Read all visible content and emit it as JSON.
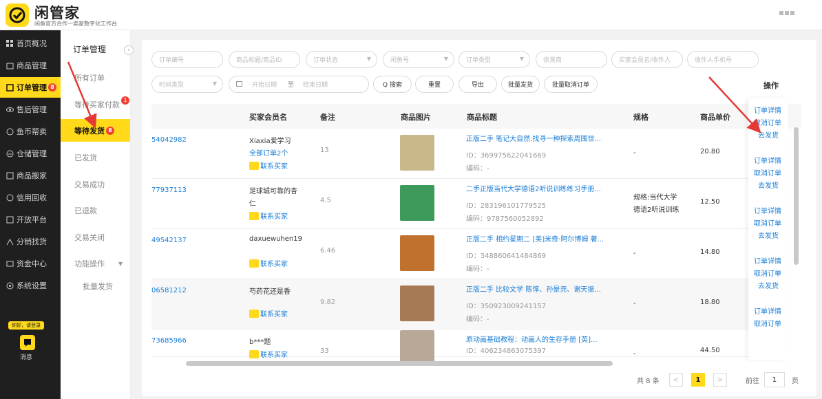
{
  "brand": {
    "title": "闲管家",
    "subtitle": "闲鱼官方合作一卖家数字化工作台"
  },
  "sidebar": {
    "items": [
      {
        "label": "首页概况",
        "icon": "grid-icon"
      },
      {
        "label": "商品管理",
        "icon": "box-icon"
      },
      {
        "label": "订单管理",
        "icon": "order-icon",
        "badge": "8"
      },
      {
        "label": "售后管理",
        "icon": "eye-icon"
      },
      {
        "label": "鱼币帮卖",
        "icon": "coin-icon"
      },
      {
        "label": "仓储管理",
        "icon": "warehouse-icon"
      },
      {
        "label": "商品搬家",
        "icon": "move-icon"
      },
      {
        "label": "信用回收",
        "icon": "recycle-icon"
      },
      {
        "label": "开放平台",
        "icon": "platform-icon"
      },
      {
        "label": "分销找货",
        "icon": "distribute-icon"
      },
      {
        "label": "资金中心",
        "icon": "money-icon"
      },
      {
        "label": "系统设置",
        "icon": "gear-icon"
      }
    ],
    "user_tag": "你好，请登录",
    "message_label": "消息"
  },
  "submenu": {
    "title": "订单管理",
    "items": [
      {
        "label": "所有订单"
      },
      {
        "label": "等待买家付款",
        "badge": "1"
      },
      {
        "label": "等待发货",
        "badge": "8"
      },
      {
        "label": "已发货"
      },
      {
        "label": "交易成功"
      },
      {
        "label": "已退款"
      },
      {
        "label": "交易关闭"
      },
      {
        "label": "功能操作"
      },
      {
        "label": "批量发货"
      }
    ]
  },
  "filters": {
    "order_no": "订单编号",
    "title_id": "商品标题/商品ID",
    "order_status": "订单状态",
    "fish_no": "闲鱼号",
    "order_type": "订单类型",
    "supplier": "供货商",
    "buyer": "买家会员名/收件人",
    "phone": "收件人手机号",
    "time_type": "时间类型",
    "start_date": "开始日期",
    "to": "至",
    "end_date": "结束日期"
  },
  "buttons": {
    "search": "Q 搜索",
    "reset": "重置",
    "export": "导出",
    "batch_ship": "批量发货",
    "batch_cancel": "批量取消订单"
  },
  "table": {
    "headers": {
      "buyer": "买家会员名",
      "note": "备注",
      "image": "商品图片",
      "title": "商品标题",
      "spec": "规格",
      "price": "商品单价",
      "ops": "操作"
    },
    "rows": [
      {
        "order": "54042982",
        "buyer_l1": "Xiaxia爱学习",
        "buyer_l2": "全部订单2个",
        "contact": "联系买家",
        "note": "13",
        "title": "正版二手 笔记大自然:找寻一种探索周围世...",
        "id": "ID：369975622041669",
        "code": "编码：-",
        "spec_l1": "-",
        "spec_l2": "",
        "price": "20.80",
        "thumb_color": "#c9b98a"
      },
      {
        "order": "77937113",
        "buyer_l1": "足球城可靠的杏",
        "buyer_l2": "仁",
        "contact": "联系买家",
        "note": "4.5",
        "title": "二手正版当代大学德语2听说训练练习手册...",
        "id": "ID：283196101779525",
        "code": "编码：9787560052892",
        "spec_l1": "规格:当代大学",
        "spec_l2": "德语2听说训练",
        "price": "12.50",
        "thumb_color": "#3d9a5a"
      },
      {
        "order": "49542137",
        "buyer_l1": "daxuewuhen19",
        "buyer_l2": "",
        "contact": "联系买家",
        "note": "6.46",
        "title": "正版二手 相约星期二 [美]米奇·阿尔博姆 著...",
        "id": "ID：348860641484869",
        "code": "编码：-",
        "spec_l1": "-",
        "spec_l2": "",
        "price": "14.80",
        "thumb_color": "#c0712e"
      },
      {
        "order": "06581212",
        "buyer_l1": "芍药花还是香",
        "buyer_l2": "",
        "contact": "联系买家",
        "note": "9.82",
        "title": "正版二手 比较文学 陈惇、孙景尧、谢天振...",
        "id": "ID：350923009241157",
        "code": "编码：-",
        "spec_l1": "-",
        "spec_l2": "",
        "price": "18.80",
        "thumb_color": "#a77a56"
      },
      {
        "order": "73685966",
        "buyer_l1": "b***题",
        "buyer_l2": "",
        "contact": "联系买家",
        "note": "33",
        "title": "原动画基础教程：动画人的生存手册 [英]...",
        "id": "ID：406234863075397",
        "code": "",
        "spec_l1": "-",
        "spec_l2": "",
        "price": "44.50",
        "thumb_color": "#b8a898"
      }
    ],
    "ops": {
      "detail": "订单详情",
      "cancel": "取消订单",
      "ship": "去发货"
    }
  },
  "pager": {
    "total": "共 8 条",
    "prev": "<",
    "current": "1",
    "next": ">",
    "goto": "前往",
    "page_input": "1",
    "page_unit": "页"
  }
}
